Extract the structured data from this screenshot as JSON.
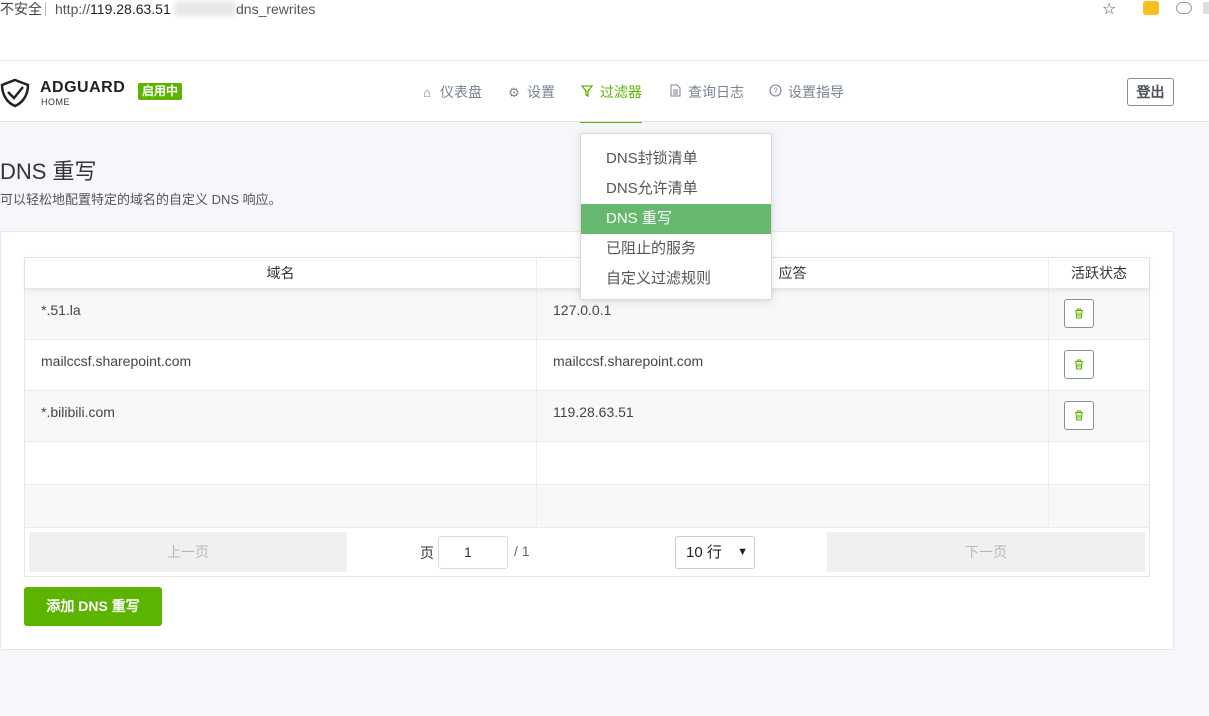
{
  "browser": {
    "security_label": "不安全",
    "url_prefix": "http://",
    "url_host": "119.28.63.51",
    "url_suffix": "dns_rewrites"
  },
  "header": {
    "brand": "ADGUARD",
    "brand_sub": "HOME",
    "status_badge": "启用中",
    "nav": [
      {
        "label": "仪表盘",
        "icon": "home-icon"
      },
      {
        "label": "设置",
        "icon": "gear-icon"
      },
      {
        "label": "过滤器",
        "icon": "filter-icon"
      },
      {
        "label": "查询日志",
        "icon": "document-icon"
      },
      {
        "label": "设置指导",
        "icon": "help-icon"
      }
    ],
    "logout_label": "登出"
  },
  "page": {
    "title": "DNS 重写",
    "description": "可以轻松地配置特定的域名的自定义 DNS 响应。"
  },
  "dropdown": {
    "items": [
      "DNS封锁清单",
      "DNS允许清单",
      "DNS 重写",
      "已阻止的服务",
      "自定义过滤规则"
    ],
    "active_index": 2
  },
  "table": {
    "headers": [
      "域名",
      "应答",
      "活跃状态"
    ],
    "rows": [
      {
        "domain": "*.51.la",
        "answer": "127.0.0.1"
      },
      {
        "domain": "mailccsf.sharepoint.com",
        "answer": "mailccsf.sharepoint.com"
      },
      {
        "domain": "*.bilibili.com",
        "answer": "119.28.63.51"
      }
    ]
  },
  "pagination": {
    "prev_label": "上一页",
    "page_label": "页",
    "current_page": "1",
    "total_pages": "/ 1",
    "page_size": "10 行",
    "next_label": "下一页"
  },
  "actions": {
    "add_label": "添加 DNS 重写"
  },
  "colors": {
    "accent": "#5cb300",
    "dropdown_active": "#66b86e"
  }
}
